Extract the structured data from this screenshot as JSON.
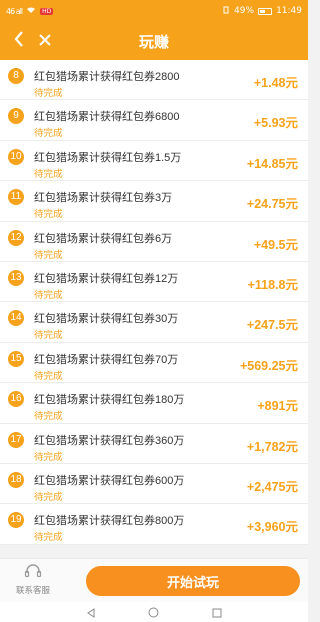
{
  "status_bar": {
    "signal_left": "46 all",
    "badge": "HD",
    "battery_text": "49%",
    "time": "11:49"
  },
  "header": {
    "title": "玩赚"
  },
  "tasks": [
    {
      "num": "8",
      "title": "红包猎场累计获得红包券2800",
      "status": "待完成",
      "reward": "+1.48元"
    },
    {
      "num": "9",
      "title": "红包猎场累计获得红包券6800",
      "status": "待完成",
      "reward": "+5.93元"
    },
    {
      "num": "10",
      "title": "红包猎场累计获得红包券1.5万",
      "status": "待完成",
      "reward": "+14.85元"
    },
    {
      "num": "11",
      "title": "红包猎场累计获得红包券3万",
      "status": "待完成",
      "reward": "+24.75元"
    },
    {
      "num": "12",
      "title": "红包猎场累计获得红包券6万",
      "status": "待完成",
      "reward": "+49.5元"
    },
    {
      "num": "13",
      "title": "红包猎场累计获得红包券12万",
      "status": "待完成",
      "reward": "+118.8元"
    },
    {
      "num": "14",
      "title": "红包猎场累计获得红包券30万",
      "status": "待完成",
      "reward": "+247.5元"
    },
    {
      "num": "15",
      "title": "红包猎场累计获得红包券70万",
      "status": "待完成",
      "reward": "+569.25元"
    },
    {
      "num": "16",
      "title": "红包猎场累计获得红包券180万",
      "status": "待完成",
      "reward": "+891元"
    },
    {
      "num": "17",
      "title": "红包猎场累计获得红包券360万",
      "status": "待完成",
      "reward": "+1,782元"
    },
    {
      "num": "18",
      "title": "红包猎场累计获得红包券600万",
      "status": "待完成",
      "reward": "+2,475元"
    },
    {
      "num": "19",
      "title": "红包猎场累计获得红包券800万",
      "status": "待完成",
      "reward": "+3,960元"
    }
  ],
  "bottom": {
    "service_label": "联系客服",
    "start_button": "开始试玩"
  },
  "colors": {
    "accent": "#f7a21b",
    "button": "#f7901e"
  },
  "icons": {
    "back": "chevron-left-icon",
    "close": "close-icon",
    "service": "headset-icon"
  }
}
